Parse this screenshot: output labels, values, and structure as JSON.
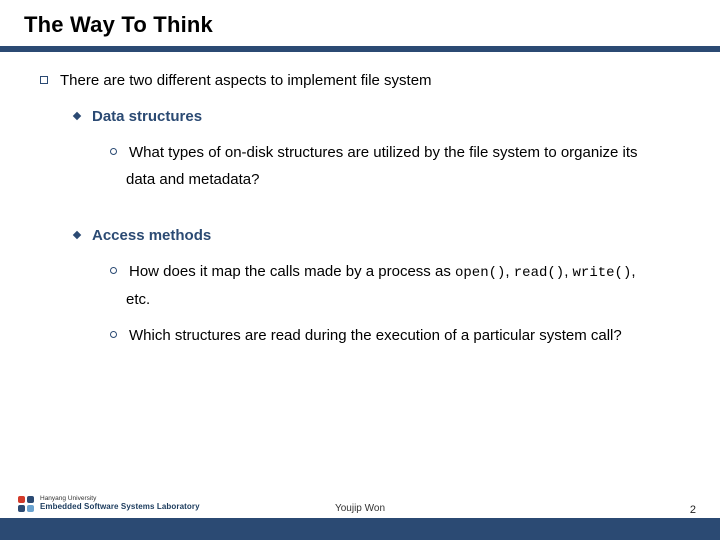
{
  "title": "The Way To Think",
  "main_point": "There are two different aspects to implement file system",
  "aspect1": {
    "heading": "Data structures",
    "detail": "What types of on-disk structures are utilized by the file system to organize its",
    "detail_cont": "data and metadata?"
  },
  "aspect2": {
    "heading": "Access methods",
    "detail1_a": "How does it map the calls made by a process as ",
    "code_open": "open()",
    "sep1": ", ",
    "code_read": "read()",
    "sep2": ", ",
    "code_write": "write()",
    "sep3": ",",
    "detail1_b": "etc.",
    "detail2": "Which structures are read during the execution of a particular system call?"
  },
  "footer": {
    "author": "Youjip Won",
    "page": "2",
    "logo_line1": "Hanyang University",
    "logo_line2": "Embedded Software Systems Laboratory"
  }
}
